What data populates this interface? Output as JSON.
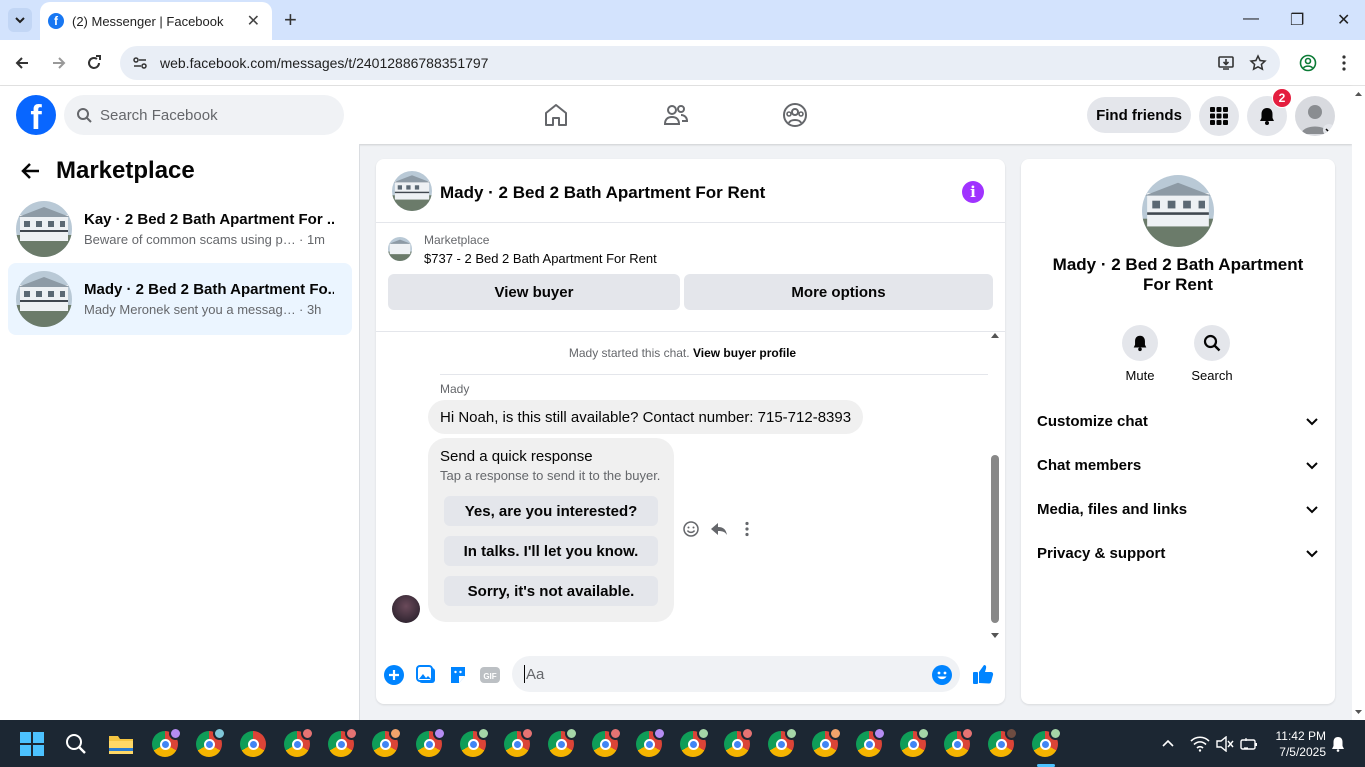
{
  "browser": {
    "tab_title": "(2) Messenger | Facebook",
    "url": "web.facebook.com/messages/t/24012886788351797"
  },
  "fb": {
    "search_placeholder": "Search Facebook",
    "find_friends": "Find friends",
    "notification_count": "2"
  },
  "sidebar": {
    "title": "Marketplace",
    "conversations": [
      {
        "name": "Kay · 2 Bed 2 Bath Apartment For ...",
        "snippet": "Beware of common scams using pay...",
        "time": "· 1m"
      },
      {
        "name": "Mady · 2 Bed 2 Bath Apartment Fo...",
        "snippet": "Mady Meronek sent you a message a...",
        "time": "· 3h"
      }
    ]
  },
  "chat": {
    "title": "Mady · 2 Bed 2 Bath Apartment For Rent",
    "marketplace_label": "Marketplace",
    "listing": "$737 - 2 Bed 2 Bath Apartment For Rent",
    "view_buyer": "View buyer",
    "more_options": "More options",
    "started_text": "Mady started this chat.",
    "view_buyer_profile": "View buyer profile",
    "sender": "Mady",
    "message": "Hi Noah, is this still available? Contact number: 715-712-8393",
    "quick_title": "Send a quick response",
    "quick_subtitle": "Tap a response to send it to the buyer.",
    "quick_responses": [
      "Yes, are you interested?",
      "In talks. I'll let you know.",
      "Sorry, it's not available."
    ],
    "input_placeholder": "Aa"
  },
  "details": {
    "name": "Mady · 2 Bed 2 Bath Apartment For Rent",
    "mute": "Mute",
    "search": "Search",
    "sections": [
      "Customize chat",
      "Chat members",
      "Media, files and links",
      "Privacy & support"
    ]
  },
  "taskbar": {
    "time": "11:42 PM",
    "date": "7/5/2025"
  },
  "colors": {
    "fb_blue": "#0866ff",
    "messenger_accent": "#0084ff",
    "info_purple": "#a033ff",
    "badge_red": "#e41e3f"
  }
}
